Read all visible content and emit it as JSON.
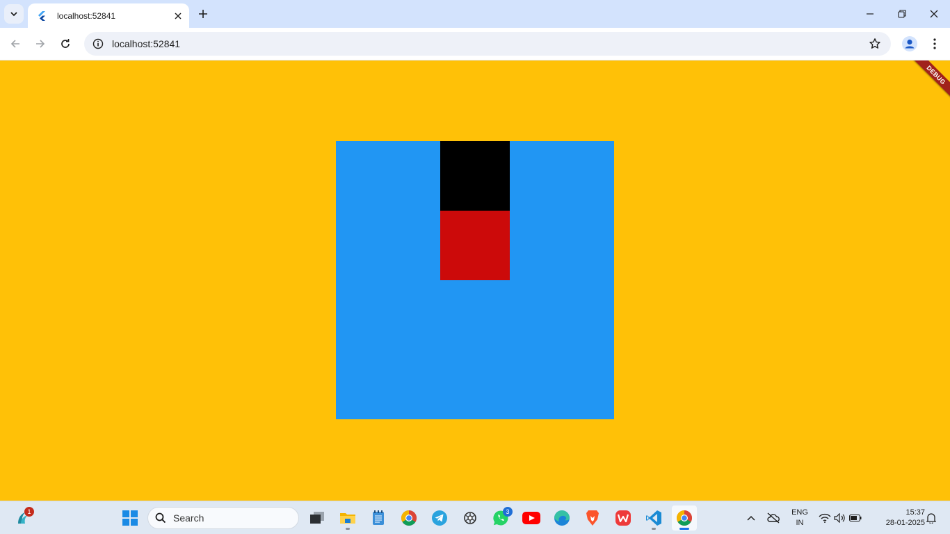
{
  "browser": {
    "tab": {
      "title": "localhost:52841"
    },
    "url": "localhost:52841"
  },
  "page": {
    "debug_banner": "DEBUG",
    "colors": {
      "background": "#ffc107",
      "outer_box": "#2196f3",
      "top_box": "#000000",
      "bottom_box": "#cc0a0a",
      "banner": "#a1221b"
    }
  },
  "taskbar": {
    "widget_badge": "1",
    "search_placeholder": "Search",
    "whatsapp_badge": "3",
    "apps": [
      "start-icon",
      "task-view-icon",
      "file-explorer-icon",
      "notepad-icon",
      "chrome-icon",
      "telegram-icon",
      "chatgpt-icon",
      "whatsapp-icon",
      "youtube-icon",
      "edge-icon",
      "brave-icon",
      "wps-icon",
      "vscode-icon",
      "chrome-active-icon"
    ],
    "tray": {
      "language": "ENG",
      "region": "IN",
      "time": "15:37",
      "date": "28-01-2025"
    }
  }
}
